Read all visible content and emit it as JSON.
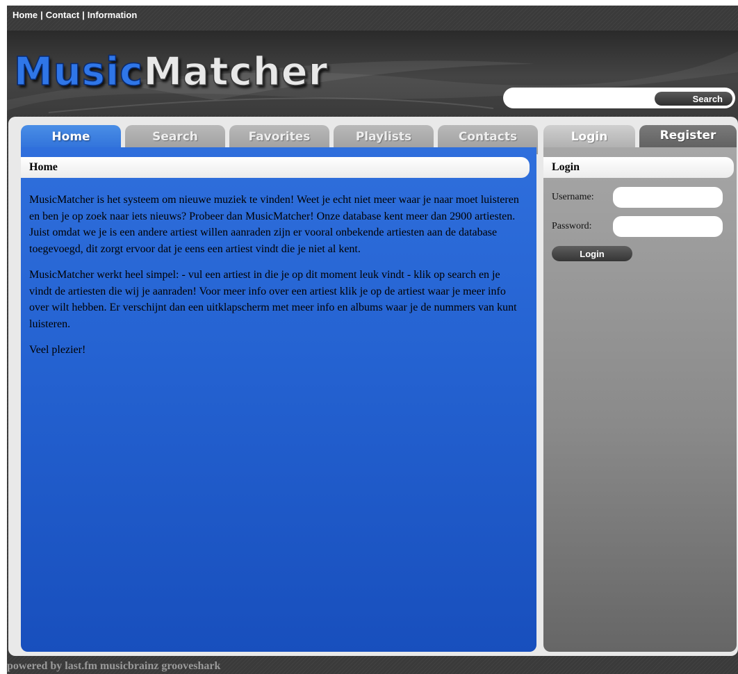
{
  "topnav": {
    "links": [
      "Home",
      "Contact",
      "Information"
    ],
    "separator": "|"
  },
  "header": {
    "logo_part1": "Music",
    "logo_part2": "Matcher",
    "search_placeholder": "",
    "search_button": "Search"
  },
  "main": {
    "tabs": [
      {
        "label": "Home",
        "active": true
      },
      {
        "label": "Search",
        "active": false
      },
      {
        "label": "Favorites",
        "active": false
      },
      {
        "label": "Playlists",
        "active": false
      },
      {
        "label": "Contacts",
        "active": false
      }
    ],
    "heading": "Home",
    "paragraphs": [
      "MusicMatcher is het systeem om nieuwe muziek te vinden! Weet je echt niet meer waar je naar moet luisteren en ben je op zoek naar iets nieuws? Probeer dan MusicMatcher! Onze database kent meer dan 2900 artiesten. Juist omdat we je is een andere artiest willen aanraden zijn er vooral onbekende artiesten aan de database toegevoegd, dit zorgt ervoor dat je eens een artiest vindt die je niet al kent.",
      "MusicMatcher werkt heel simpel: - vul een artiest in die je op dit moment leuk vindt - klik op search en je vindt de artiesten die wij je aanraden! Voor meer info over een artiest klik je op de artiest waar je meer info over wilt hebben. Er verschijnt dan een uitklapscherm met meer info en albums waar je de nummers van kunt luisteren.",
      "Veel plezier!"
    ]
  },
  "side": {
    "tabs": [
      {
        "label": "Login",
        "active": true
      },
      {
        "label": "Register",
        "active": false
      }
    ],
    "heading": "Login",
    "username_label": "Username:",
    "password_label": "Password:",
    "login_button": "Login"
  },
  "footer": {
    "text": "powered by last.fm musicbrainz grooveshark"
  },
  "colors": {
    "accent_blue": "#2b6cd8",
    "panel_gray": "#8a8a8a",
    "background_dark": "#3a3a3a"
  }
}
